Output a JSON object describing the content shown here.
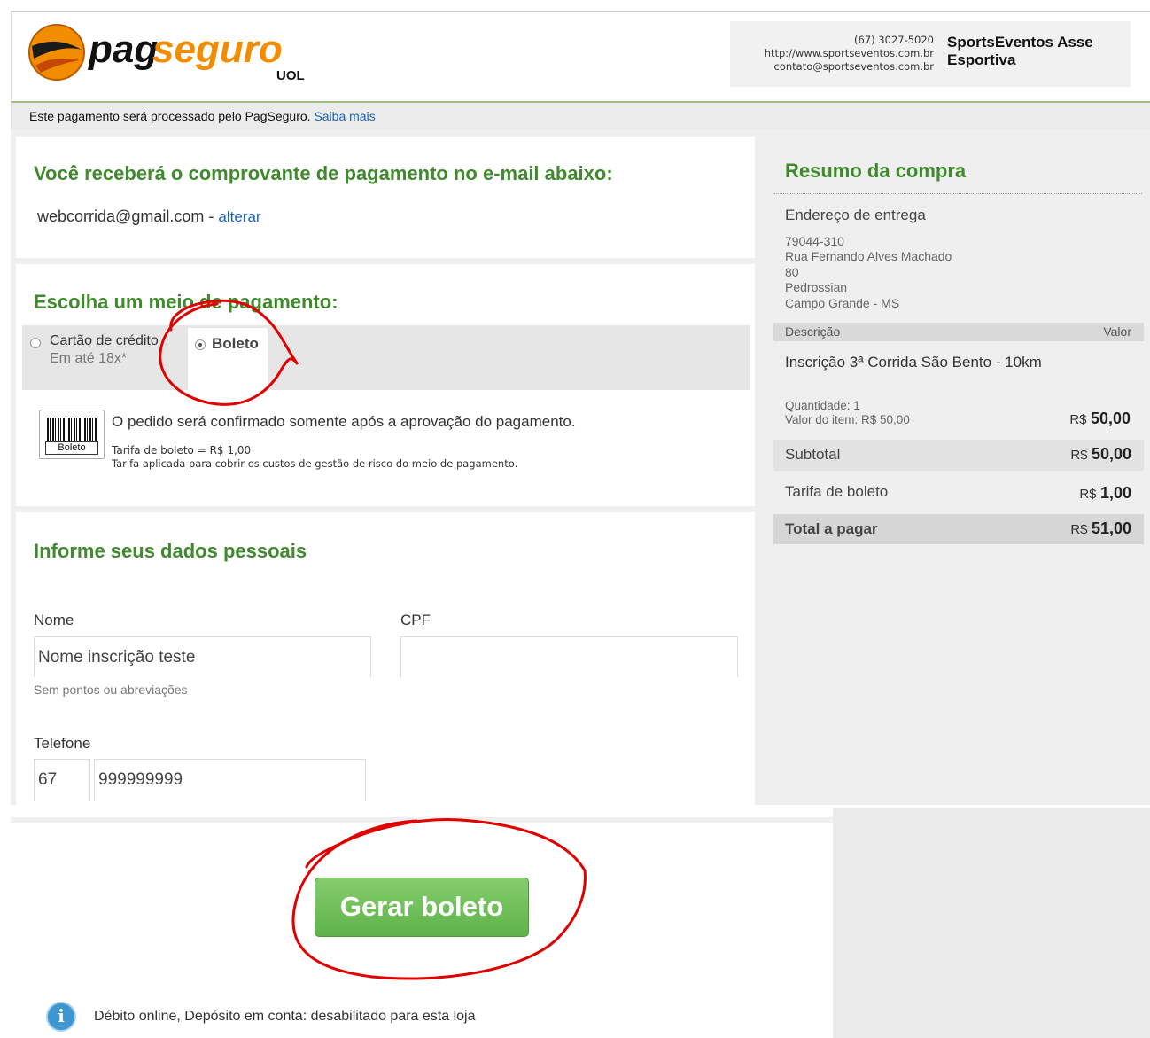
{
  "header": {
    "logo_main_pag": "pag",
    "logo_main_seguro": "seguro",
    "logo_sub": "UOL",
    "store_phone": "(67) 3027-5020",
    "store_url": "http://www.sportseventos.com.br",
    "store_email": "contato@sportseventos.com.br",
    "store_name": "SportsEventos Asse Esportiva"
  },
  "notice": {
    "text": "Este pagamento será processado pelo PagSeguro.",
    "link": "Saiba mais"
  },
  "email_section": {
    "heading": "Você receberá o comprovante de pagamento no e-mail abaixo:",
    "email": "webcorrida@gmail.com",
    "separator": "-",
    "change_link": "alterar"
  },
  "payment_section": {
    "heading": "Escolha um meio de pagamento:",
    "options": [
      {
        "label": "Cartão de crédito",
        "sublabel": "Em até 18x*",
        "selected": false
      },
      {
        "label": "Boleto",
        "sublabel": "",
        "selected": true
      }
    ],
    "boleto_icon_label": "Boleto",
    "boleto_message": "O pedido será confirmado somente após a aprovação do pagamento.",
    "boleto_fee": "Tarifa de boleto = R$ 1,00",
    "boleto_fee_note": "Tarifa aplicada para cobrir os custos de gestão de risco do meio de pagamento."
  },
  "personal_section": {
    "heading": "Informe seus dados pessoais",
    "name_label": "Nome",
    "name_value": "Nome inscrição teste",
    "name_hint": "Sem pontos ou abreviações",
    "cpf_label": "CPF",
    "cpf_value": "",
    "phone_label": "Telefone",
    "phone_ddd": "67",
    "phone_number": "999999999"
  },
  "summary": {
    "title": "Resumo da compra",
    "address_heading": "Endereço de entrega",
    "address_lines": [
      "79044-310",
      "Rua Fernando Alves Machado",
      "80",
      "Pedrossian",
      "Campo Grande - MS"
    ],
    "col_description": "Descrição",
    "col_value": "Valor",
    "item_name": "Inscrição 3ª Corrida São Bento - 10km",
    "item_quantity": "Quantidade: 1",
    "item_unit_value": "Valor do item: R$ 50,00",
    "item_currency": "R$",
    "item_total": "50,00",
    "subtotal_label": "Subtotal",
    "subtotal_currency": "R$",
    "subtotal_value": "50,00",
    "fee_label": "Tarifa de boleto",
    "fee_currency": "R$",
    "fee_value": "1,00",
    "total_label": "Total a pagar",
    "total_currency": "R$",
    "total_value": "51,00"
  },
  "actions": {
    "generate_button": "Gerar boleto",
    "info_icon": "i",
    "info_text": "Débito online, Depósito em conta: desabilitado para esta loja"
  },
  "colors": {
    "brand_green": "#3f8a2c",
    "link_blue": "#1a64b5",
    "button_green": "#6fbf5a",
    "annotation_red": "#e00000",
    "logo_orange": "#f28c00"
  }
}
